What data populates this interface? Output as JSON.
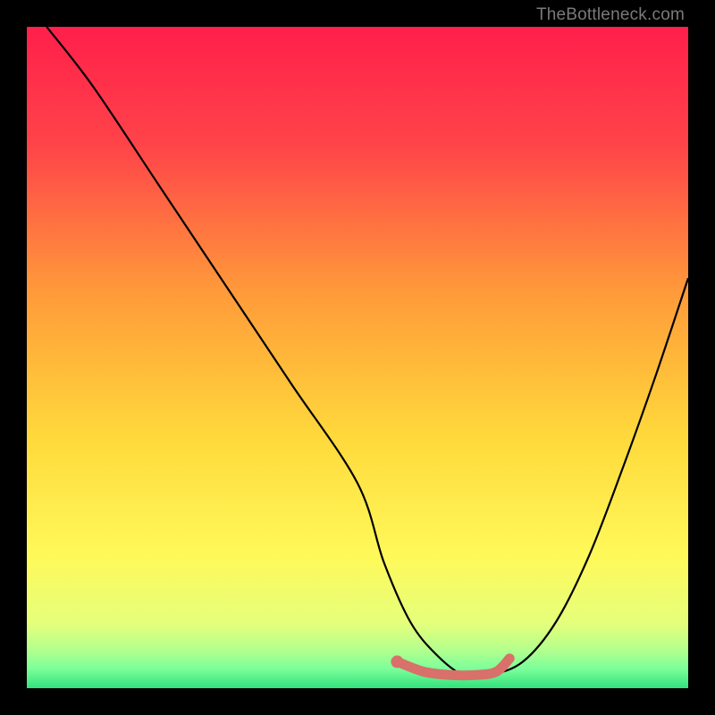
{
  "watermark": "TheBottleneck.com",
  "chart_data": {
    "type": "line",
    "title": "",
    "xlabel": "",
    "ylabel": "",
    "x_range": [
      0,
      100
    ],
    "y_range": [
      0,
      100
    ],
    "series": [
      {
        "name": "bottleneck-curve",
        "color": "#000000",
        "x": [
          3,
          10,
          20,
          30,
          40,
          50,
          54,
          58,
          62,
          66,
          70,
          75,
          80,
          85,
          90,
          95,
          100
        ],
        "y": [
          100,
          91,
          76,
          61,
          46,
          31,
          19,
          10,
          5,
          2,
          2,
          4,
          10,
          20,
          33,
          47,
          62
        ]
      },
      {
        "name": "highlight-segment",
        "color": "#d9706a",
        "x": [
          56,
          60,
          64,
          68,
          71,
          73
        ],
        "y": [
          4.0,
          2.5,
          2.0,
          2.0,
          2.5,
          4.5
        ]
      }
    ],
    "highlight_dot": {
      "x": 56,
      "y": 4.0,
      "color": "#d9706a"
    },
    "background_gradient": {
      "stops": [
        {
          "offset": 0.0,
          "color": "#ff1f4b"
        },
        {
          "offset": 0.18,
          "color": "#ff4449"
        },
        {
          "offset": 0.4,
          "color": "#ff9a3a"
        },
        {
          "offset": 0.62,
          "color": "#ffd93b"
        },
        {
          "offset": 0.8,
          "color": "#fff95a"
        },
        {
          "offset": 0.9,
          "color": "#e6ff7a"
        },
        {
          "offset": 0.94,
          "color": "#b7ff8c"
        },
        {
          "offset": 0.97,
          "color": "#7dff9a"
        },
        {
          "offset": 1.0,
          "color": "#32e27e"
        }
      ]
    }
  }
}
